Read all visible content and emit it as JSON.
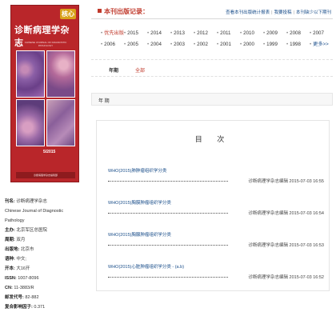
{
  "cover": {
    "badge": "核心",
    "title": "诊断病理学杂志",
    "sub_en": "CHINESE JOURNAL OF DIAGNOSTIC",
    "sub_en2": "PATHOLOGY",
    "issue": "5/2015",
    "publisher": "诊断病理学杂志编辑部"
  },
  "info": [
    {
      "label": "刊名:",
      "value": "诊断病理学杂志"
    },
    {
      "label": "",
      "value": "Chinese Journal of Diagnostic"
    },
    {
      "label": "",
      "value": "Pathology"
    },
    {
      "label": "主办:",
      "value": "北京军区总医院"
    },
    {
      "label": "周期:",
      "value": "双月"
    },
    {
      "label": "出版地:",
      "value": "北京市"
    },
    {
      "label": "语种:",
      "value": "中文;"
    },
    {
      "label": "开本:",
      "value": "大16开"
    },
    {
      "label": "ISSN:",
      "value": "1007-8096"
    },
    {
      "label": "CN:",
      "value": "11-3883/R"
    },
    {
      "label": "邮发代号:",
      "value": "82-882"
    },
    {
      "label": "复合影响因子:",
      "value": "0.371"
    }
  ],
  "header": {
    "title": "本刊出版记录：",
    "links": [
      "查看本刊出版统计报表",
      "我要投稿",
      "本刊缺少以下期刊"
    ]
  },
  "years_row1": [
    {
      "label": "优先出版",
      "active": true
    },
    {
      "label": "2015",
      "active": false
    },
    {
      "label": "2014",
      "active": false
    },
    {
      "label": "2013",
      "active": false
    },
    {
      "label": "2012",
      "active": false
    },
    {
      "label": "2011",
      "active": false
    },
    {
      "label": "2010",
      "active": false
    },
    {
      "label": "2009",
      "active": false
    },
    {
      "label": "2008",
      "active": false
    },
    {
      "label": "2007",
      "active": false
    }
  ],
  "years_row2": [
    {
      "label": "2006"
    },
    {
      "label": "2005"
    },
    {
      "label": "2004"
    },
    {
      "label": "2003"
    },
    {
      "label": "2002"
    },
    {
      "label": "2001"
    },
    {
      "label": "2000"
    },
    {
      "label": "1999"
    },
    {
      "label": "1998"
    },
    {
      "label": "更多>>"
    }
  ],
  "filter": {
    "label": "年期",
    "value": "全部"
  },
  "issue_label": "年 期",
  "toc": {
    "title": "目 次",
    "articles": [
      {
        "title": "WHO(2015)肺肿瘤组织学分类",
        "meta": "诊断病理学杂志编辑   2015-07-03 16:55"
      },
      {
        "title": "WHO(2015)胸膜肿瘤组织学分类",
        "meta": "诊断病理学杂志编辑   2015-07-03 16:54"
      },
      {
        "title": "WHO(2015)胸腺肿瘤组织学分类",
        "meta": "诊断病理学杂志编辑   2015-07-03 16:53"
      },
      {
        "title": "WHO(2015)心脏肿瘤组织学分类 - (a.b)",
        "meta": "诊断病理学杂志编辑   2015-07-03 16:52"
      }
    ]
  },
  "colors": {
    "accent": "#c0392b",
    "link": "#1a4e8a",
    "cover": "#b9262a"
  }
}
